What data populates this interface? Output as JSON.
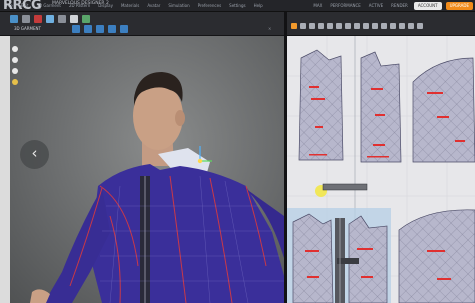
{
  "app": {
    "title": "MARVELOUS DESIGNER 2",
    "logo": "RRCG"
  },
  "menu": {
    "left": [
      "File",
      "Edit",
      "3D Garment",
      "2D Pattern",
      "Display",
      "Materials",
      "Avatar",
      "Simulation",
      "Preferences",
      "Settings",
      "Help"
    ],
    "right": [
      "MAX",
      "PERFORMANCE",
      "ACTIVE",
      "RENDER"
    ],
    "buttons": [
      "ACCOUNT",
      "UPGRADE"
    ]
  },
  "viewport3d": {
    "tab_label": "3D GARMENT",
    "nav_prev_icon": "chevron-left-icon"
  },
  "viewport2d": {
    "tab_label": "2D PATTERN"
  },
  "colors": {
    "accent": "#f28c1b",
    "garment": "#3a2f9a",
    "seam": "#e23a3a",
    "pattern_fill": "#b7b7cc",
    "selected_pattern": "#b5cfe6"
  }
}
